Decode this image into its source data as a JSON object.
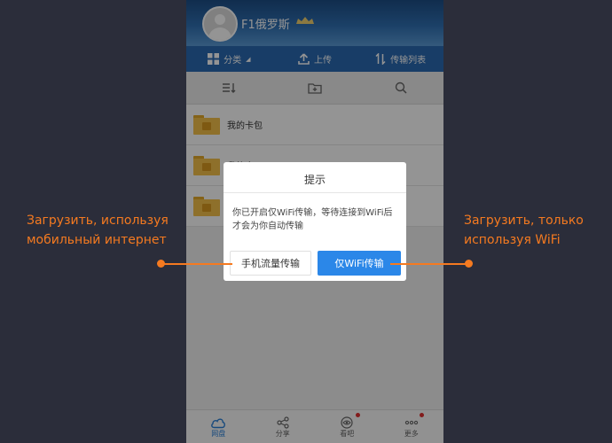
{
  "header": {
    "username": "F1俄罗斯"
  },
  "tabs": [
    {
      "label": "分类",
      "icon": "grid-icon"
    },
    {
      "label": "上传",
      "icon": "upload-icon"
    },
    {
      "label": "传输列表",
      "icon": "transfer-icon"
    }
  ],
  "toolbar": {
    "icons": [
      "sort-icon",
      "new-folder-icon",
      "search-icon"
    ]
  },
  "list": {
    "items": [
      {
        "label": "我的卡包"
      },
      {
        "label": "我的应用"
      },
      {
        "label": ""
      }
    ]
  },
  "dialog": {
    "title": "提示",
    "message": "你已开启仅WiFi传输，等待连接到WiFi后才会为你自动传输",
    "cellular_button": "手机流量传输",
    "wifi_button": "仅WiFi传输"
  },
  "bottom_nav": [
    {
      "label": "网盘",
      "icon": "cloud-icon",
      "active": true
    },
    {
      "label": "分享",
      "icon": "share-icon"
    },
    {
      "label": "看吧",
      "icon": "eye-icon",
      "badge": true
    },
    {
      "label": "更多",
      "icon": "more-icon",
      "badge": true
    }
  ],
  "annotations": {
    "left": "Загрузить, используя мобильный интернет",
    "right": "Загрузить, только используя WiFi"
  },
  "colors": {
    "accent": "#f57a20",
    "primary": "#2b87e8",
    "background": "#2b2d3a"
  }
}
